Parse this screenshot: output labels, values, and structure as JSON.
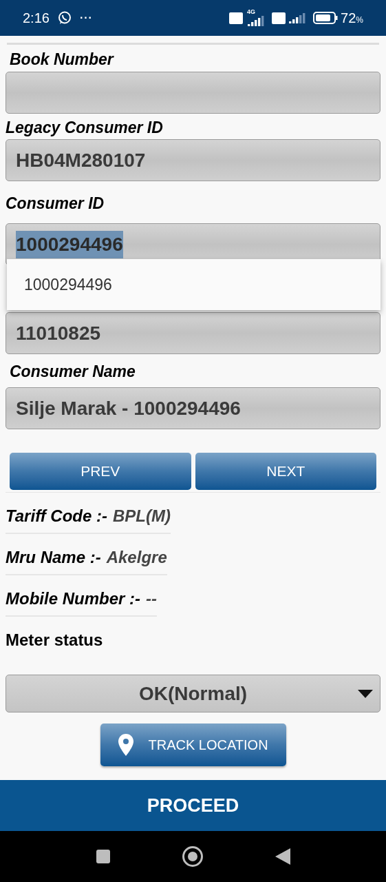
{
  "status_bar": {
    "time": "2:16",
    "more": "···",
    "network": "4G",
    "battery": "72",
    "battery_unit": "%"
  },
  "fields": [
    {
      "label": "Book Number"
    },
    {
      "label": "Legacy Consumer ID",
      "value": "HB04M280107",
      "highlighted": false
    },
    {
      "label": "Consumer ID",
      "value": "1000294496",
      "highlighted": true
    },
    {
      "value": "11010825",
      "highlighted": false
    },
    {
      "label": "Consumer Name",
      "value": "Silje Marak - 1000294496",
      "highlighted": false
    }
  ],
  "suggestions": [
    "1000294496"
  ],
  "nav_buttons": [
    "PREV",
    "NEXT"
  ],
  "info": [
    {
      "label": "Tariff Code :-",
      "value": "BPL(M)"
    },
    {
      "label": "Mru Name :-",
      "value": "Akelgre"
    },
    {
      "label": "Mobile Number :-",
      "value": "--"
    }
  ],
  "meter_status": {
    "label": "Meter status",
    "value": "OK(Normal)"
  },
  "track_button": "TRACK LOCATION",
  "proceed_button": "PROCEED"
}
